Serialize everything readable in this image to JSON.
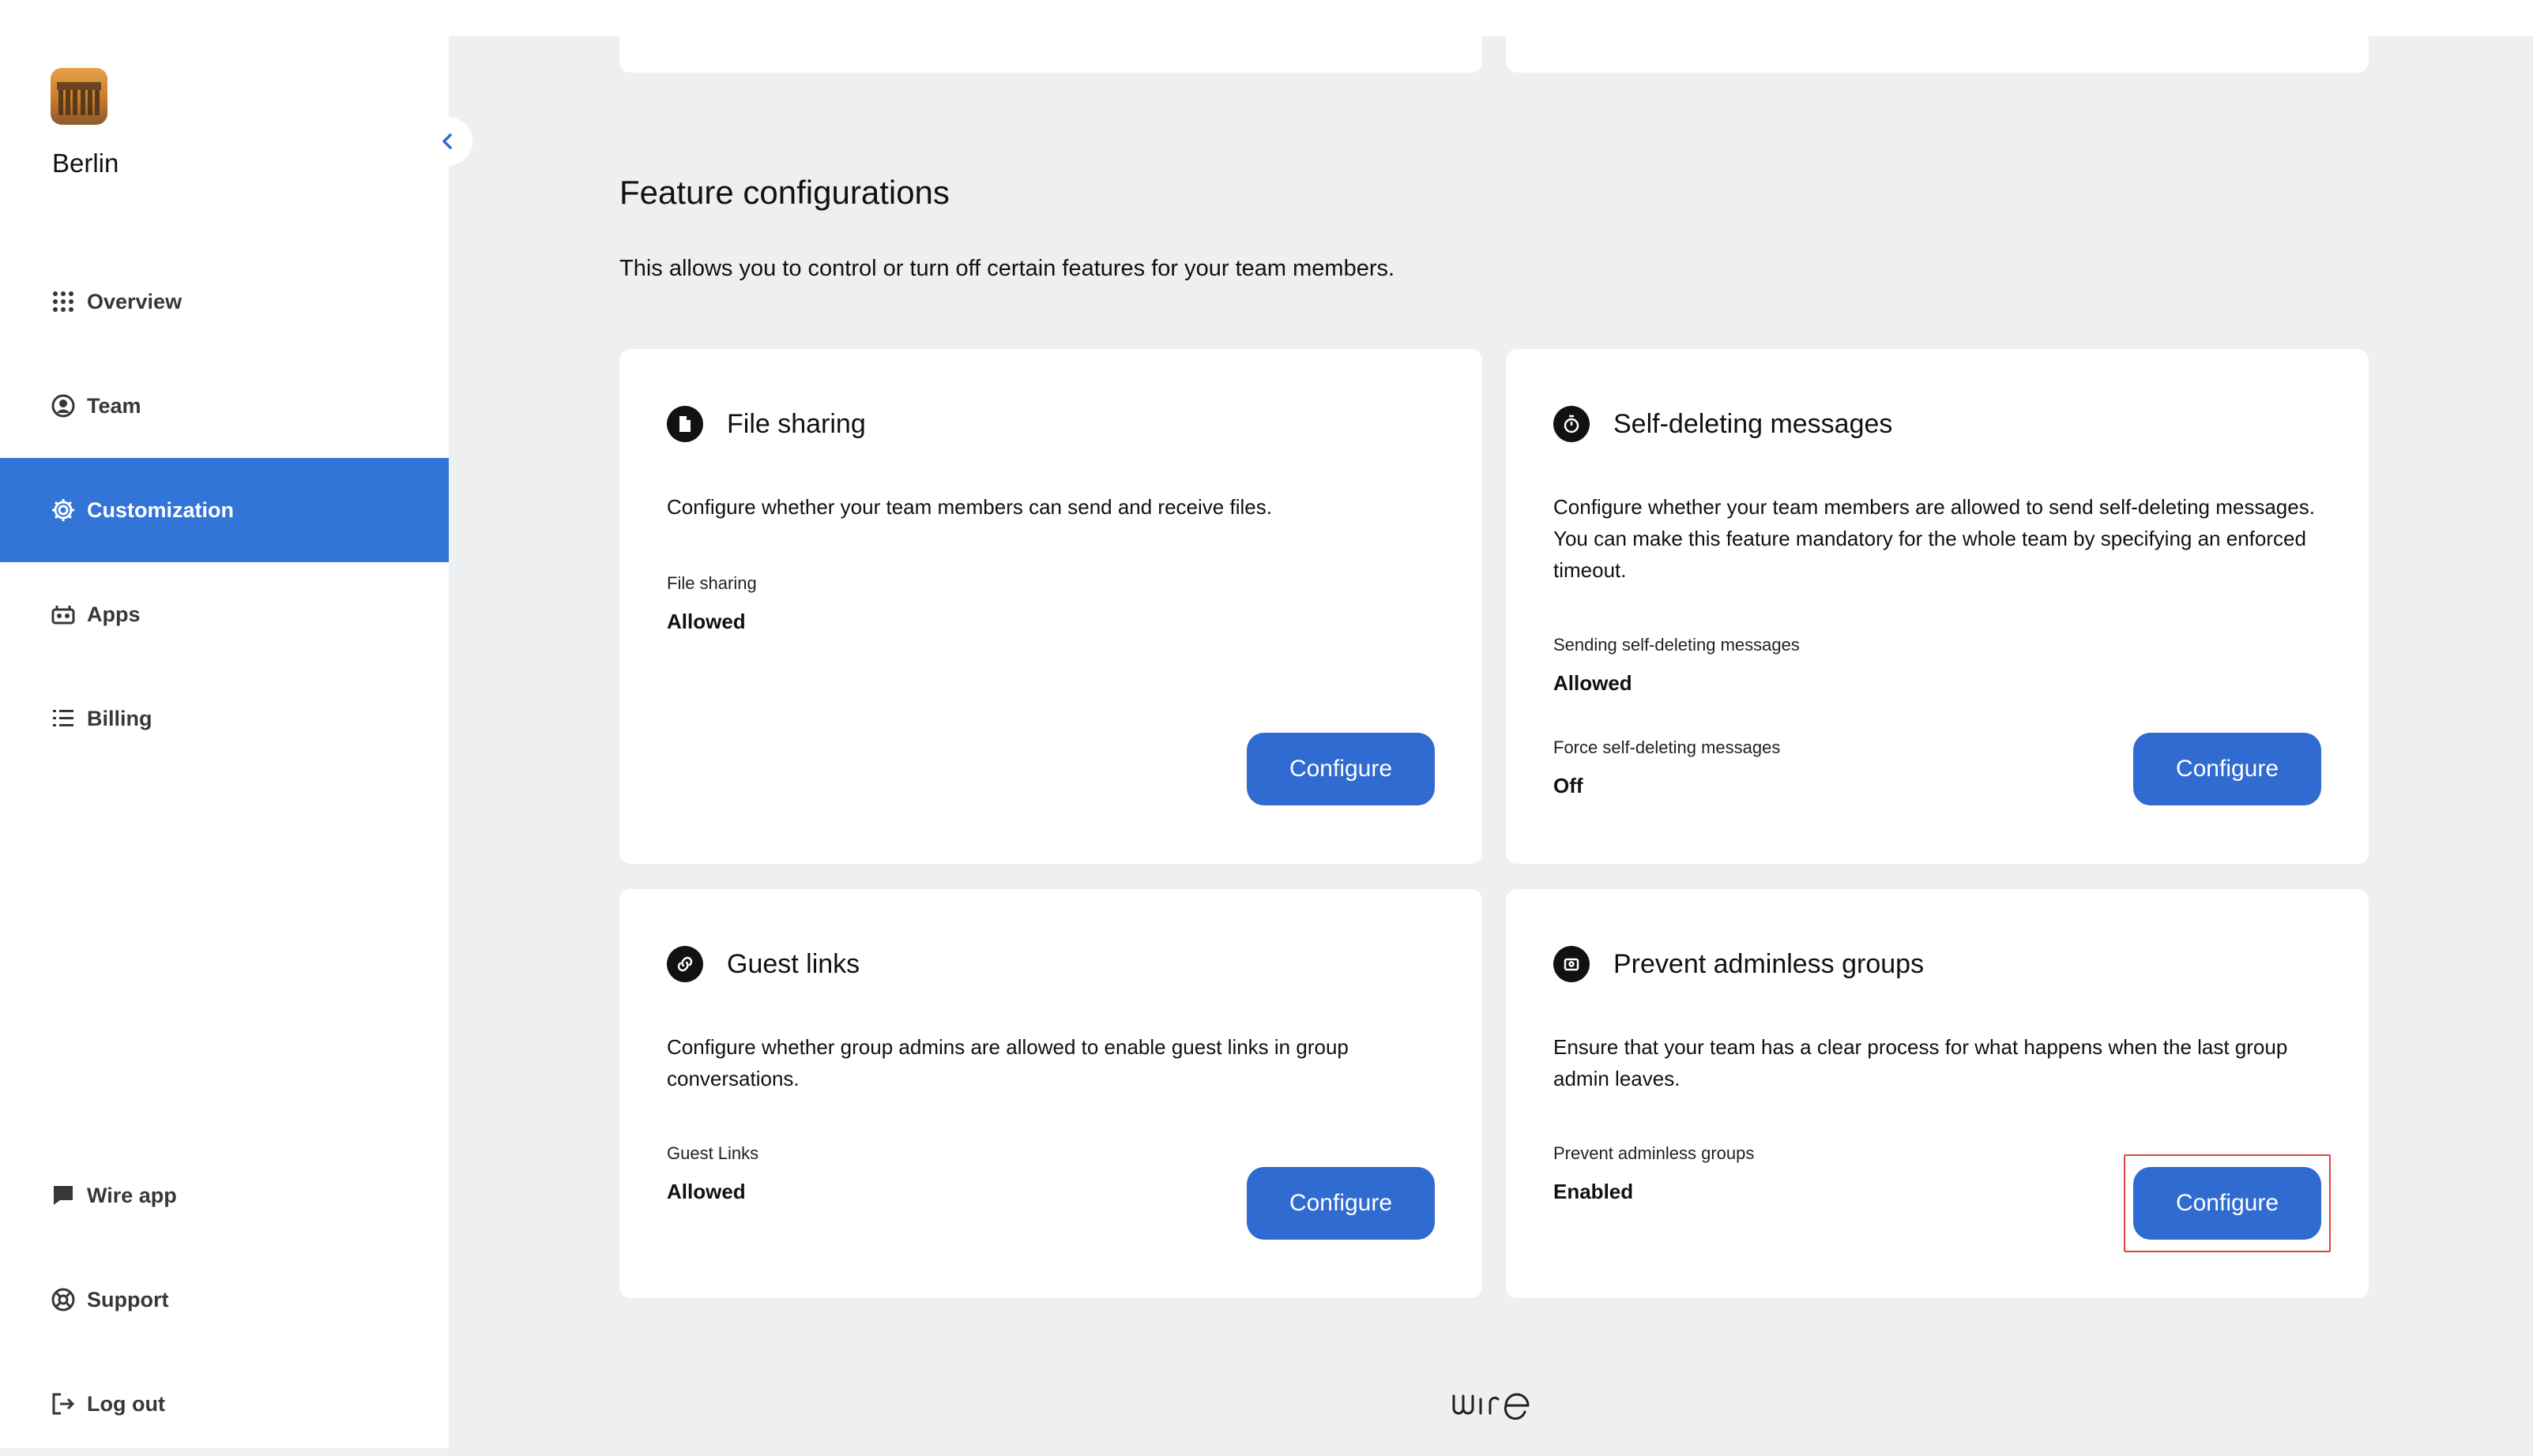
{
  "sidebar": {
    "team_name": "Berlin",
    "collapse_icon": "chevron-left-icon",
    "items": [
      {
        "label": "Overview",
        "icon": "grid-icon"
      },
      {
        "label": "Team",
        "icon": "user-circle-icon"
      },
      {
        "label": "Customization",
        "icon": "gear-icon",
        "active": true
      },
      {
        "label": "Apps",
        "icon": "apps-icon"
      },
      {
        "label": "Billing",
        "icon": "list-icon"
      }
    ],
    "bottom_items": [
      {
        "label": "Wire app",
        "icon": "chat-bubble-icon"
      },
      {
        "label": "Support",
        "icon": "lifebuoy-icon"
      },
      {
        "label": "Log out",
        "icon": "logout-icon"
      }
    ]
  },
  "main": {
    "title": "Feature configurations",
    "description": "This allows you to control or turn off certain features for your team members.",
    "cards": [
      {
        "title": "File sharing",
        "icon": "file-icon",
        "description": "Configure whether your team members can send and receive files.",
        "fields": [
          {
            "label": "File sharing",
            "value": "Allowed"
          }
        ],
        "button_label": "Configure"
      },
      {
        "title": "Self-deleting messages",
        "icon": "timer-icon",
        "description": "Configure whether your team members are allowed to send self-deleting messages. You can make this feature mandatory for the whole team by specifying an enforced timeout.",
        "fields": [
          {
            "label": "Sending self-deleting messages",
            "value": "Allowed"
          },
          {
            "label": "Force self-deleting messages",
            "value": "Off"
          }
        ],
        "button_label": "Configure"
      },
      {
        "title": "Guest links",
        "icon": "link-icon",
        "description": "Configure whether group admins are allowed to enable guest links in group conversations.",
        "fields": [
          {
            "label": "Guest Links",
            "value": "Allowed"
          }
        ],
        "button_label": "Configure"
      },
      {
        "title": "Prevent adminless groups",
        "icon": "admin-shield-icon",
        "description": "Ensure that your team has a clear process for what happens when the last group admin leaves.",
        "fields": [
          {
            "label": "Prevent adminless groups",
            "value": "Enabled"
          }
        ],
        "button_label": "Configure"
      }
    ]
  },
  "footer": {
    "logo_text": "wire"
  },
  "colors": {
    "accent": "#3274d8",
    "button": "#2f6bd0",
    "background": "#edeff0",
    "highlight": "#e0463f"
  }
}
